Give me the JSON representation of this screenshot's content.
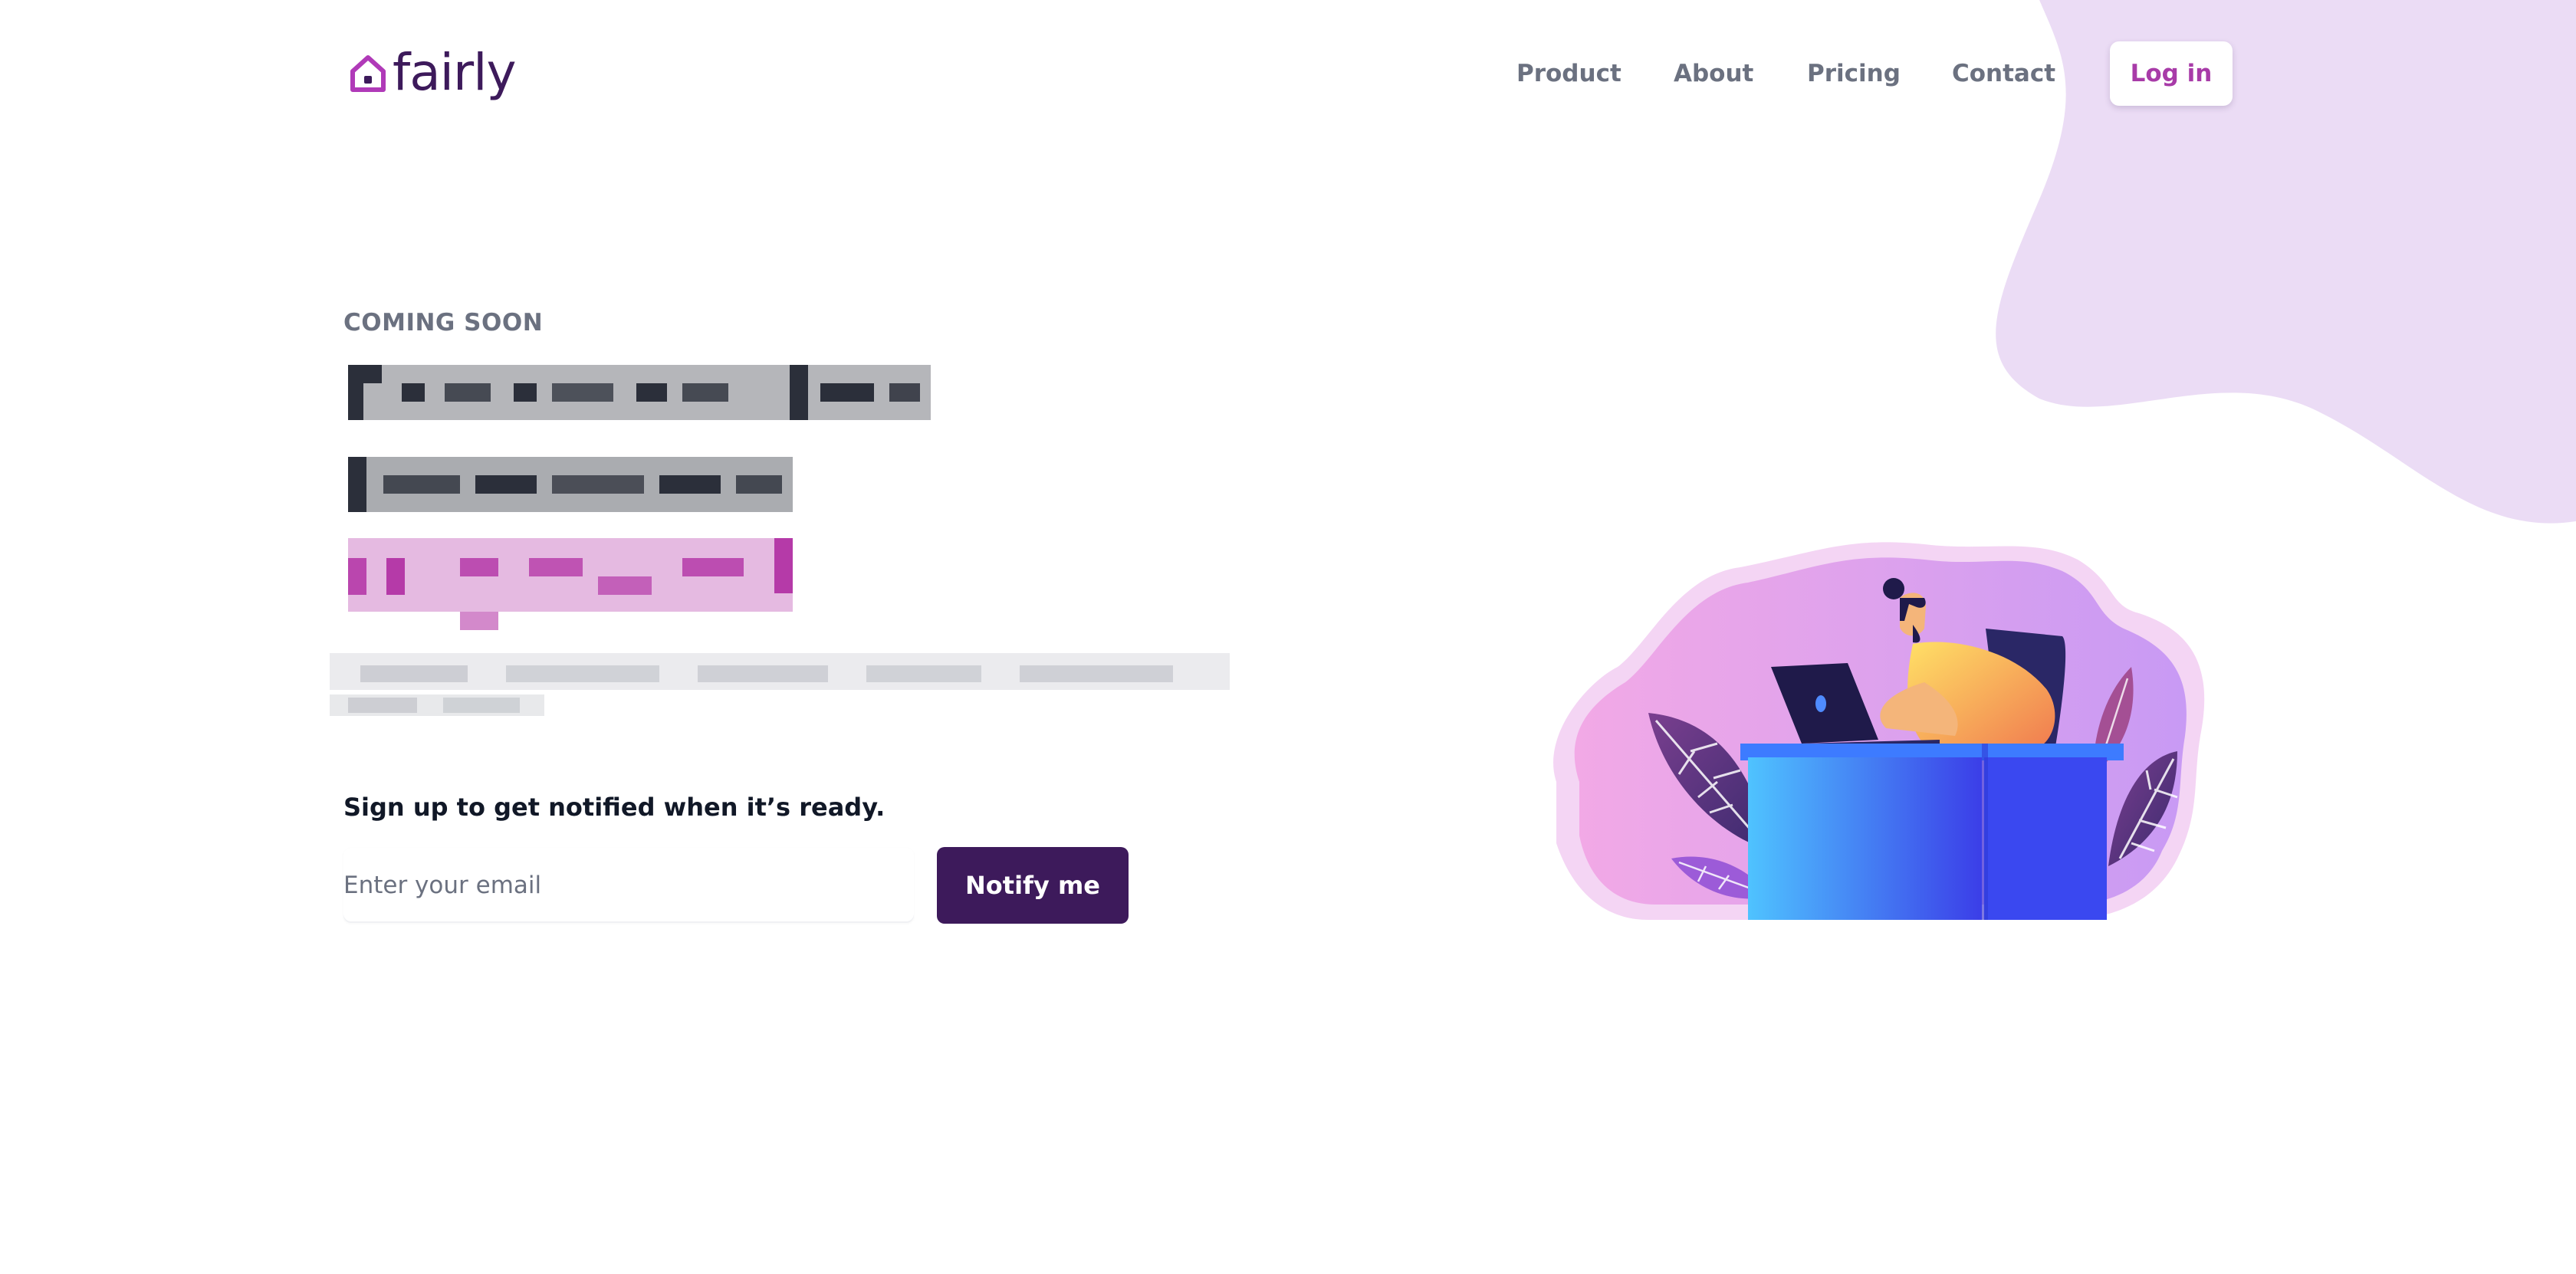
{
  "brand": {
    "name": "fairly",
    "icon": "house-icon"
  },
  "nav": {
    "items": [
      {
        "label": "Product"
      },
      {
        "label": "About"
      },
      {
        "label": "Pricing"
      },
      {
        "label": "Contact"
      }
    ],
    "login_label": "Log in"
  },
  "hero": {
    "eyebrow": "COMING SOON",
    "headline_redacted": true,
    "description_redacted": true
  },
  "signup": {
    "prompt": "Sign up to get notified when it’s ready.",
    "email_placeholder": "Enter your email",
    "email_value": "",
    "button_label": "Notify me"
  },
  "colors": {
    "brand_dark": "#3d1a5b",
    "brand_accent": "#a83ba8",
    "nav_gray": "#6b7180",
    "blob_lavender": "#ebdcf5"
  }
}
